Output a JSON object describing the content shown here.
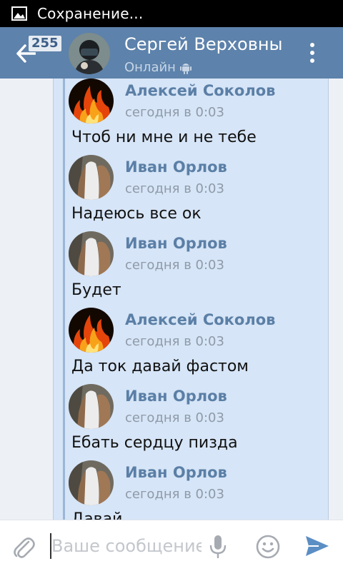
{
  "status_bar": {
    "text": "Сохранение..."
  },
  "header": {
    "unread_count": "255",
    "title": "Сергей Верховный",
    "status": "Онлайн"
  },
  "messages": [
    {
      "author": "Алексей Соколов",
      "time": "сегодня в 0:03",
      "text": "Чтоб ни мне и не тебе",
      "avatar_icon": "fire-avatar"
    },
    {
      "author": "Иван Орлов",
      "time": "сегодня в 0:03",
      "text": "Надеюсь все ок",
      "avatar_icon": "person-avatar"
    },
    {
      "author": "Иван Орлов",
      "time": "сегодня в 0:03",
      "text": "Будет",
      "avatar_icon": "person-avatar"
    },
    {
      "author": "Алексей Соколов",
      "time": "сегодня в 0:03",
      "text": "Да ток давай фастом",
      "avatar_icon": "fire-avatar"
    },
    {
      "author": "Иван Орлов",
      "time": "сегодня в 0:03",
      "text": "Ебать сердцу пизда",
      "avatar_icon": "person-avatar"
    },
    {
      "author": "Иван Орлов",
      "time": "сегодня в 0:03",
      "text": "Давай",
      "avatar_icon": "person-avatar"
    }
  ],
  "composer": {
    "placeholder": "Ваше сообщение"
  },
  "colors": {
    "app_bar": "#5d82ab",
    "bubble": "#d6e5f7",
    "author": "#5b7fa6",
    "send": "#5b8ec4"
  }
}
